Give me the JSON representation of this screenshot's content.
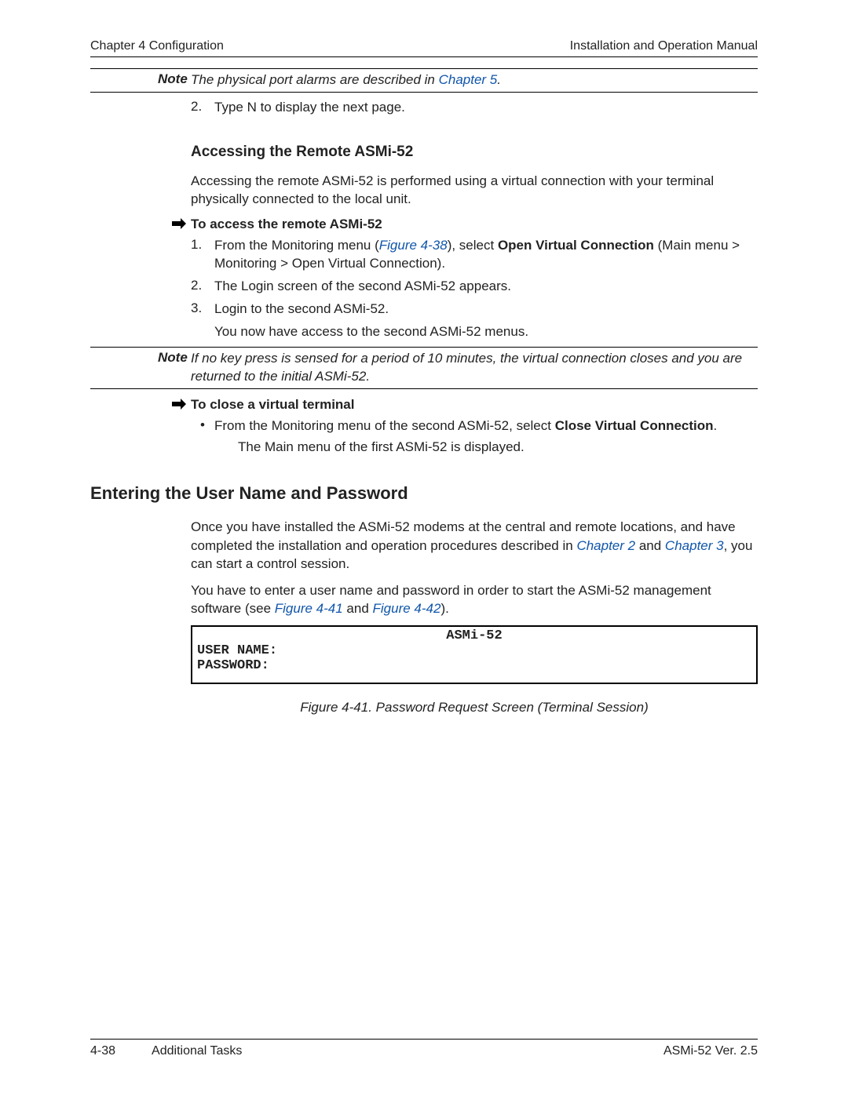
{
  "header": {
    "left": "Chapter 4  Configuration",
    "right": "Installation and Operation Manual"
  },
  "note1": {
    "label": "Note",
    "text_before_link": "The physical port alarms are described in ",
    "link": "Chapter 5",
    "text_after_link": "."
  },
  "step_pre": {
    "num": "2.",
    "text": "Type N to display the next page."
  },
  "h3_access": "Accessing the Remote ASMi-52",
  "para_access": "Accessing the remote ASMi-52 is performed using a virtual connection with your terminal physically connected to the local unit.",
  "proc_access": "To access the remote ASMi-52",
  "steps_access": {
    "s1": {
      "num": "1.",
      "pre": "From the Monitoring menu (",
      "link": "Figure 4-38",
      "mid": "), select ",
      "bold": "Open Virtual Connection",
      "post": " (Main menu > Monitoring > Open Virtual Connection)."
    },
    "s2": {
      "num": "2.",
      "text": "The Login screen of the second ASMi-52 appears."
    },
    "s3": {
      "num": "3.",
      "text": "Login to the second ASMi-52."
    },
    "s3_sub": "You now have access to the second ASMi-52 menus."
  },
  "note2": {
    "label": "Note",
    "text": "If no key press is sensed for a period of 10 minutes, the virtual connection closes and you are returned to the initial ASMi-52."
  },
  "proc_close": "To close a virtual terminal",
  "bullet_close": {
    "pre": "From the Monitoring menu of the second ASMi-52, select ",
    "bold": "Close Virtual Connection",
    "post": "."
  },
  "close_sub": "The Main menu of the first ASMi-52 is displayed.",
  "h2_enter": "Entering the User Name and Password",
  "para_enter1": {
    "pre": "Once you have installed the ASMi-52 modems at the central and remote locations, and have completed the installation and operation procedures described in ",
    "link1": "Chapter 2",
    "mid": " and ",
    "link2": "Chapter 3",
    "post": ", you can start a control session."
  },
  "para_enter2": {
    "pre": "You have to enter a user name and password in order to start the ASMi-52 management software (see ",
    "link1": "Figure 4-41",
    "mid": " and ",
    "link2": "Figure 4-42",
    "post": ")."
  },
  "terminal": {
    "title": "ASMi-52",
    "line1": "USER NAME:",
    "line2": "PASSWORD:"
  },
  "fig_caption": "Figure 4-41.  Password Request Screen (Terminal Session)",
  "footer": {
    "left_num": "4-38",
    "left_text": "Additional Tasks",
    "right": "ASMi-52 Ver. 2.5"
  }
}
